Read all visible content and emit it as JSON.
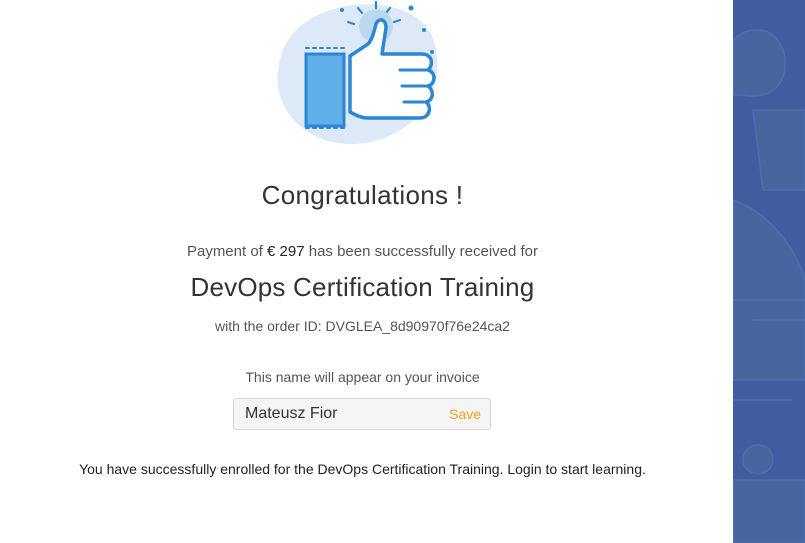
{
  "confirmation": {
    "title": "Congratulations !",
    "payment_prefix": "Payment of",
    "payment_amount": "€ 297",
    "payment_suffix": "has been successfully received for",
    "course_name": "DevOps Certification Training",
    "order_text": "with the order ID: DVGLEA_8d90970f76e24ca2"
  },
  "invoice": {
    "hint": "This name will appear on your invoice",
    "name_value": "Mateusz Fior",
    "save_label": "Save"
  },
  "footer": {
    "enrolled_message": "You have successfully enrolled for the DevOps Certification Training. Login to start learning."
  },
  "colors": {
    "accent_blue": "#2b86d4",
    "light_blue": "#5fb0e8",
    "blob": "#dde9f6",
    "side_panel": "#3f5d9f",
    "save_orange": "#f0a024"
  },
  "icons": {
    "hero": "thumbs-up-icon"
  }
}
